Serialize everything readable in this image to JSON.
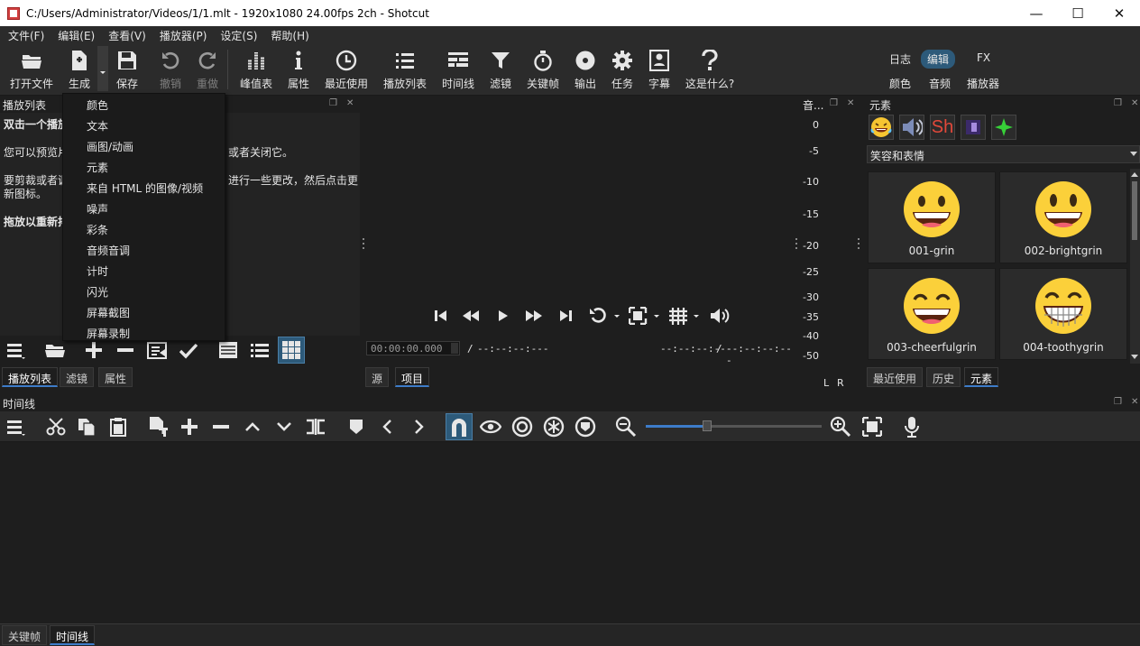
{
  "window": {
    "title": "C:/Users/Administrator/Videos/1/1.mlt - 1920x1080 24.00fps 2ch - Shotcut",
    "minimize": "—",
    "maximize": "☐",
    "close": "✕"
  },
  "menu": [
    "文件(F)",
    "编辑(E)",
    "查看(V)",
    "播放器(P)",
    "设定(S)",
    "帮助(H)"
  ],
  "toolbar": {
    "open": "打开文件",
    "generate": "生成",
    "save": "保存",
    "undo": "撤销",
    "redo": "重做",
    "peak": "峰值表",
    "properties": "属性",
    "recent": "最近使用",
    "playlist": "播放列表",
    "timeline": "时间线",
    "filters": "滤镜",
    "keyframes": "关键帧",
    "export": "输出",
    "jobs": "任务",
    "subtitles": "字幕",
    "whatsthis": "这是什么?"
  },
  "layouts": {
    "row1": [
      "日志",
      "编辑",
      "FX"
    ],
    "row2": [
      "颜色",
      "音频",
      "播放器"
    ],
    "active": "编辑"
  },
  "playlist": {
    "title": "播放列表",
    "lines": [
      "双击一个播放",
      "您可以预览片",
      "要剪裁或者调",
      "新图标。",
      "拖放以重新排"
    ],
    "right_lines": [
      "或者关闭它。",
      "进行一些更改，然后点击更"
    ],
    "tabs": [
      "播放列表",
      "滤镜",
      "属性"
    ]
  },
  "generate_menu": {
    "items": [
      "颜色",
      "文本",
      "画图/动画",
      "元素",
      "来自 HTML 的图像/视频",
      "噪声",
      "彩条",
      "音频音调",
      "计时",
      "闪光",
      "屏幕截图",
      "屏幕录制"
    ]
  },
  "player": {
    "timecode": "00:00:00.000",
    "position_sep": "/",
    "duration": "--:--:--:---",
    "in_point": "--:--:--:---",
    "out_sep": "/",
    "out_point": "--:--:--:---",
    "tabs": [
      "源",
      "项目"
    ],
    "active_tab": "项目"
  },
  "meter": {
    "title": "音...",
    "scale": [
      "0",
      "-5",
      "-10",
      "-15",
      "-20",
      "-25",
      "-30",
      "-35",
      "-40",
      "-50"
    ],
    "channels": [
      "L",
      "R"
    ]
  },
  "elements": {
    "title": "元素",
    "category": "笑容和表情",
    "items": [
      "001-grin",
      "002-brightgrin",
      "003-cheerfulgrin",
      "004-toothygrin"
    ],
    "tabs": [
      "最近使用",
      "历史",
      "元素"
    ],
    "active_tab": "元素",
    "sh_label": "Sh"
  },
  "timeline": {
    "title": "时间线",
    "zoom_level": 0.35
  },
  "bottom_tabs": [
    "关键帧",
    "时间线"
  ],
  "bottom_active": "时间线",
  "colors": {
    "bg": "#1e1e1e",
    "panel": "#2b2b2b",
    "accent": "#3d7cc9",
    "active_layout": "#2d5a7a",
    "snap": "#2d5a7a"
  }
}
